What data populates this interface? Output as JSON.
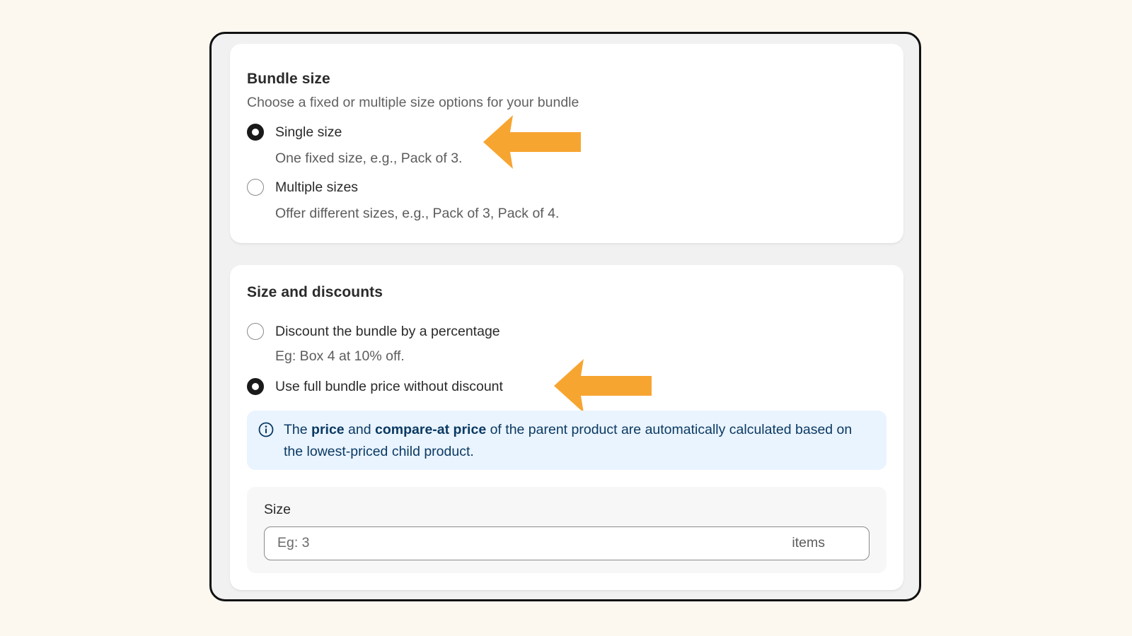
{
  "bundle_size": {
    "title": "Bundle size",
    "subtitle": "Choose a fixed or multiple size options for your bundle",
    "options": [
      {
        "label": "Single size",
        "help": "One fixed size, e.g., Pack of 3.",
        "checked": true
      },
      {
        "label": "Multiple sizes",
        "help": "Offer different sizes, e.g., Pack of 3, Pack of 4.",
        "checked": false
      }
    ]
  },
  "size_discounts": {
    "title": "Size and discounts",
    "options": [
      {
        "label": "Discount the bundle by a percentage",
        "help": "Eg: Box 4 at 10% off.",
        "checked": false
      },
      {
        "label": "Use full bundle price without discount",
        "checked": true
      }
    ],
    "info_banner": {
      "icon": "info-icon",
      "text_1": "The ",
      "bold_1": "price",
      "text_2": " and ",
      "bold_2": "compare-at price",
      "text_3": " of the parent product are automatically calculated based on the lowest-priced child product."
    },
    "size_field": {
      "label": "Size",
      "placeholder": "Eg: 3",
      "suffix": "items"
    }
  },
  "annotations": {
    "arrow_icon": "arrow-left-icon",
    "arrow_color": "#f7a531"
  },
  "colors": {
    "page_background": "#fcf8f0",
    "frame_border": "#111111",
    "banner_background": "#eaf4ff",
    "banner_text": "#0b3a63"
  }
}
